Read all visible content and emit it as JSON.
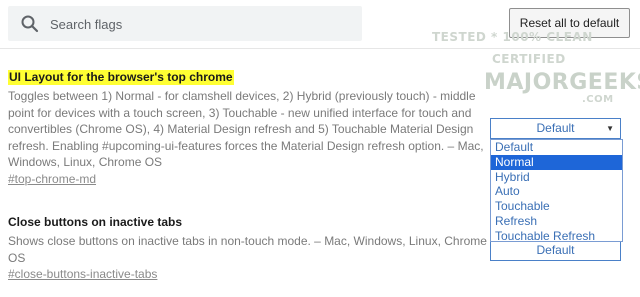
{
  "search": {
    "placeholder": "Search flags"
  },
  "toolbar": {
    "reset_label": "Reset all to default"
  },
  "watermark": {
    "line1": "TESTED * 100% CLEAN",
    "line2": "CERTIFIED",
    "line3": "MAJORGEEKS",
    "line4": ".COM"
  },
  "flags": [
    {
      "title": "UI Layout for the browser's top chrome",
      "description_lines": [
        "Toggles between 1) Normal - for clamshell devices, 2) Hybrid (previously touch) - middle",
        "point for devices with a touch screen, 3) Touchable - new unified interface for touch and",
        "convertibles (Chrome OS), 4) Material Design refresh and 5) Touchable Material Design",
        "refresh. Enabling #upcoming-ui-features forces the Material Design refresh option. – Mac,",
        "Windows, Linux, Chrome OS"
      ],
      "link": "#top-chrome-md",
      "select_value": "Default",
      "dropdown_options": [
        "Default",
        "Normal",
        "Hybrid",
        "Auto",
        "Touchable",
        "Refresh",
        "Touchable Refresh"
      ],
      "highlighted_option": "Normal"
    },
    {
      "title": "Close buttons on inactive tabs",
      "description_lines": [
        "Shows close buttons on inactive tabs in non-touch mode. – Mac, Windows, Linux, Chrome",
        "OS"
      ],
      "link": "#close-buttons-inactive-tabs",
      "select_value": "Default"
    }
  ],
  "colors": {
    "highlight": "#ffff33",
    "selected_option": "#1e66d8",
    "option_text": "#3a6fb5"
  },
  "icons": {
    "search": "search-icon",
    "dropdown": "chevron-down-icon"
  }
}
